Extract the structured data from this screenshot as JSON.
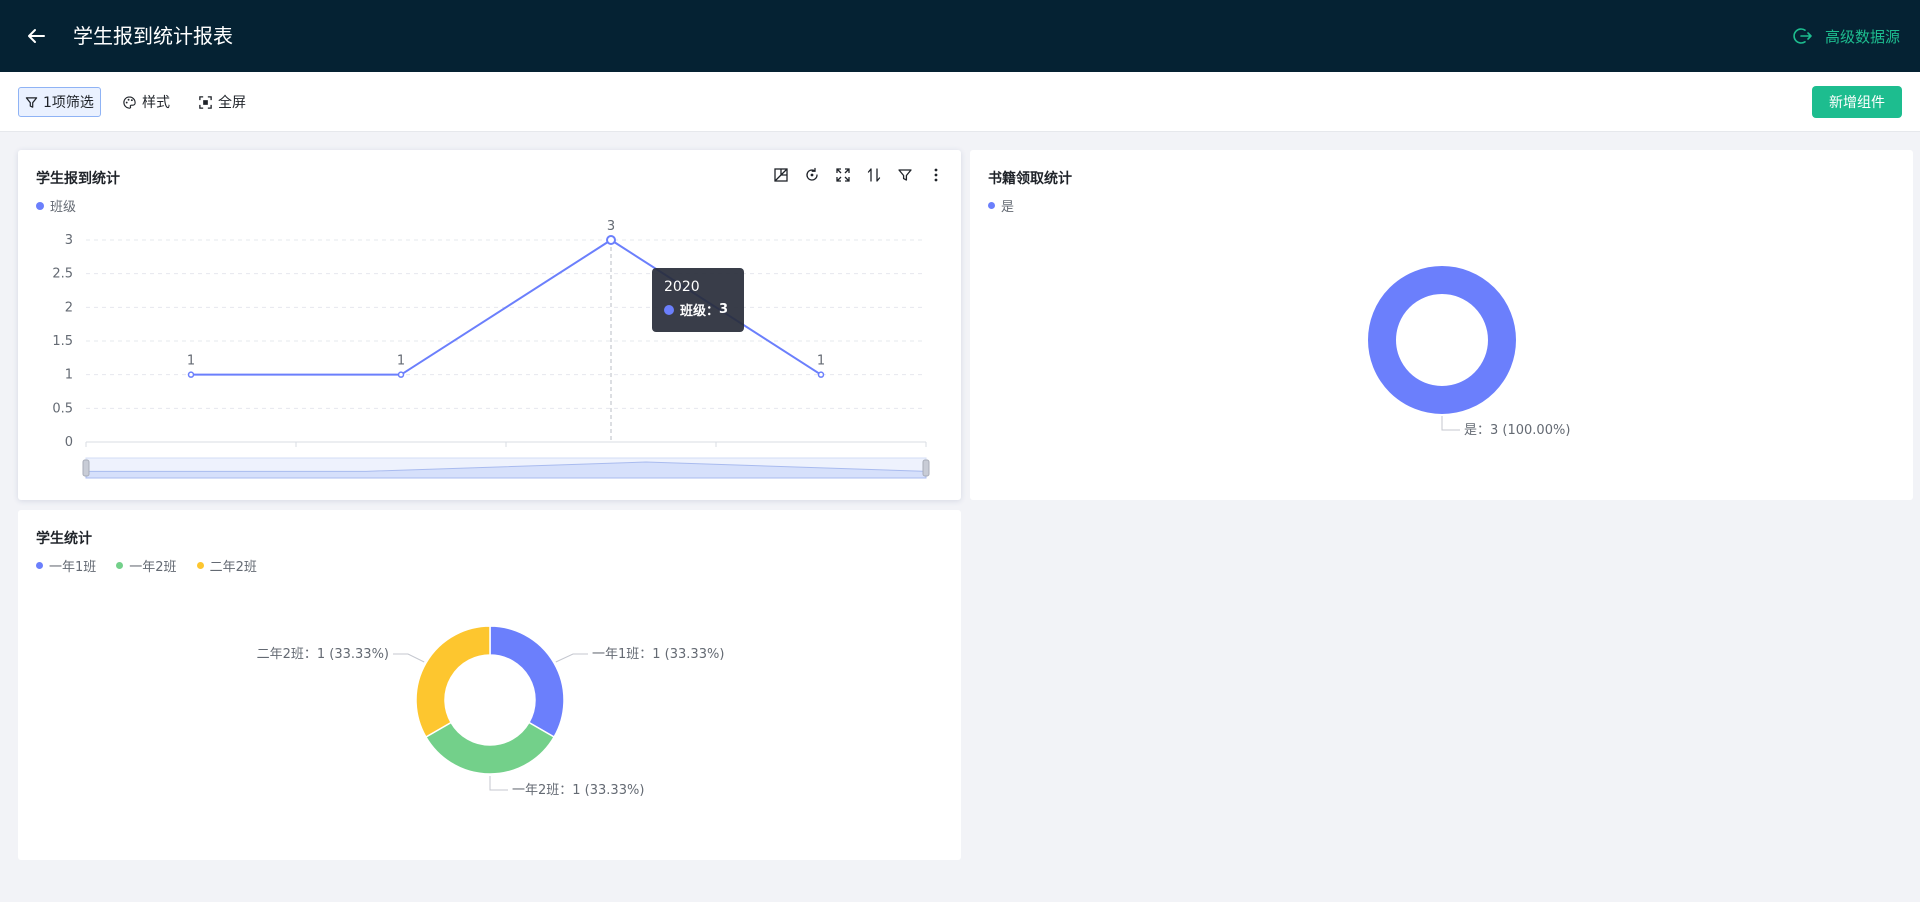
{
  "header": {
    "title": "学生报到统计报表",
    "back_icon": "arrow-left-icon",
    "advanced_source_label": "高级数据源"
  },
  "toolbar": {
    "filter_label": "1项筛选",
    "style_label": "样式",
    "fullscreen_label": "全屏",
    "add_component_label": "新增组件"
  },
  "colors": {
    "header_bg": "#052233",
    "accent_green": "#1dbd8f",
    "series_blue": "#6b7ffc",
    "series_green": "#73d08a",
    "series_yellow": "#fdc62f"
  },
  "cards": {
    "enroll": {
      "title": "学生报到统计",
      "legend": "班级",
      "tooltip_title": "2020",
      "tooltip_series": "班级",
      "tooltip_value": "3"
    },
    "books": {
      "title": "书籍领取统计",
      "legend": "是",
      "slice_label": "是：3 (100.00%)"
    },
    "students": {
      "title": "学生统计",
      "legend": [
        "一年1班",
        "一年2班",
        "二年2班"
      ],
      "slice_labels": [
        "一年1班：1 (33.33%)",
        "一年2班：1 (33.33%)",
        "二年2班：1 (33.33%)"
      ]
    }
  },
  "chart_data": [
    {
      "type": "line",
      "title": "学生报到统计",
      "series": [
        {
          "name": "班级",
          "values": [
            1,
            1,
            3,
            1
          ]
        }
      ],
      "data_labels": [
        "1",
        "1",
        "3",
        "1"
      ],
      "yticks": [
        "0",
        "0.5",
        "1",
        "1.5",
        "2",
        "2.5",
        "3"
      ],
      "ylim": [
        0,
        3
      ],
      "grid": true,
      "legend": "top-left",
      "tooltip_category": "2020"
    },
    {
      "type": "pie",
      "title": "书籍领取统计",
      "donut": true,
      "categories": [
        "是"
      ],
      "values": [
        3
      ],
      "percents": [
        100.0
      ],
      "legend": "top-left"
    },
    {
      "type": "pie",
      "title": "学生统计",
      "donut": true,
      "categories": [
        "一年1班",
        "一年2班",
        "二年2班"
      ],
      "values": [
        1,
        1,
        1
      ],
      "percents": [
        33.33,
        33.33,
        33.33
      ],
      "legend": "top-left"
    }
  ]
}
